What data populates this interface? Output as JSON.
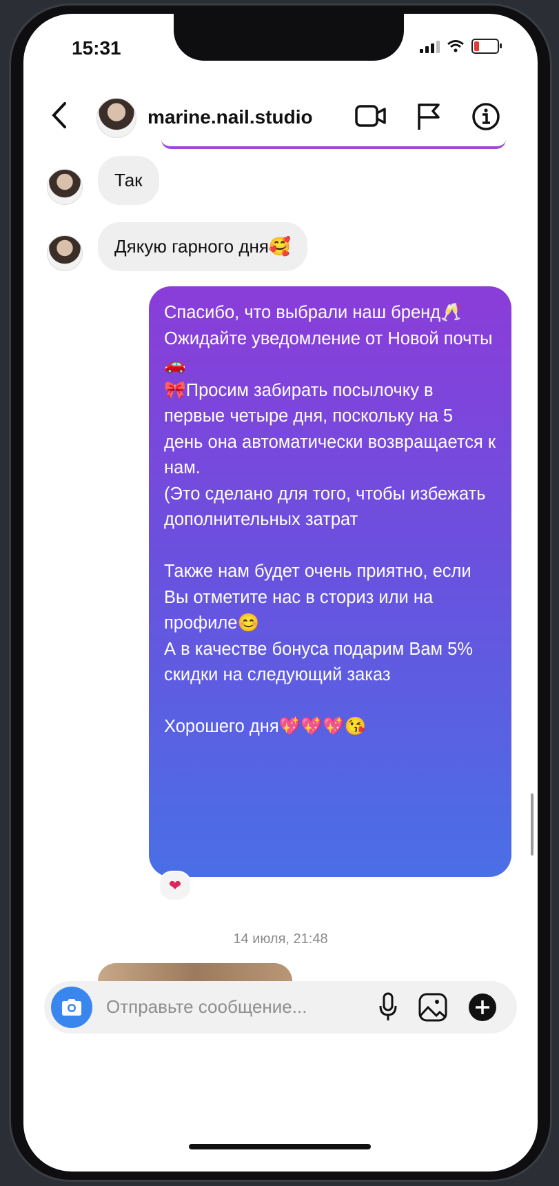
{
  "status": {
    "time": "15:31"
  },
  "header": {
    "username": "marine.nail.studio"
  },
  "messages": {
    "in1": "Так",
    "in2": "Дякую гарного дня🥰",
    "out": "Спасибо, что выбрали наш бренд🥂\nОжидайте уведомление от Новой почты🚗\n🎀Просим забирать посылочку в первые четыре дня, поскольку на 5 день она автоматически возвращается к нам.\n(Это сделано для того, чтобы избежать дополнительных затрат\n\nТакже нам будет очень приятно, если Вы отметите нас в сториз или на профиле😊\nА в качестве бонуса подарим Вам 5% скидки на следующий заказ\n\nХорошего дня💖💖💖😘",
    "reaction": "❤"
  },
  "date_separator": "14 июля, 21:48",
  "composer": {
    "placeholder": "Отправьте сообщение..."
  },
  "icons": [
    "back-chevron-icon",
    "video-call-icon",
    "flag-icon",
    "info-icon",
    "camera-icon",
    "microphone-icon",
    "gallery-icon",
    "plus-icon"
  ],
  "colors": {
    "bubble_gradient_top": "#8b3dd9",
    "bubble_gradient_bottom": "#4a6fe6",
    "camera_button": "#3a86ef"
  }
}
